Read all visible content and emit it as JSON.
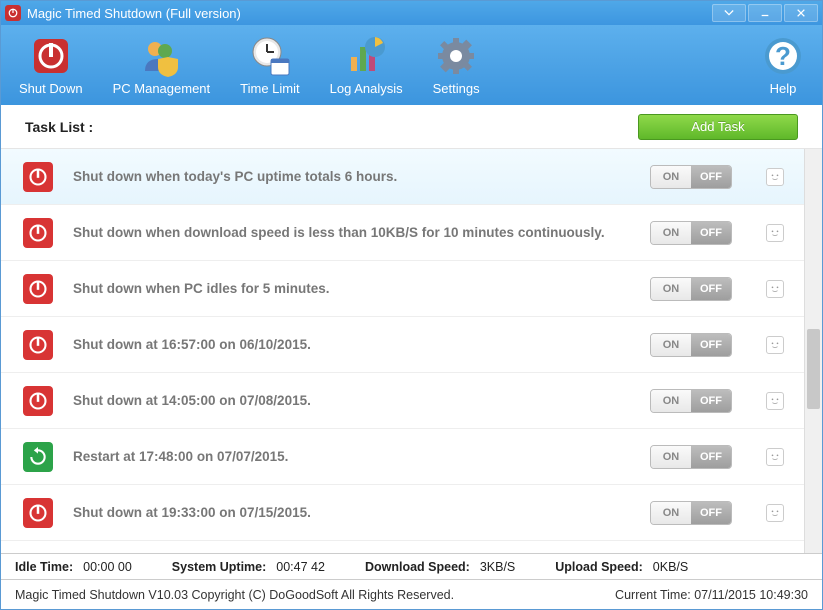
{
  "titlebar": {
    "title": "Magic Timed Shutdown (Full version)"
  },
  "toolbar": {
    "shutdown": "Shut Down",
    "pc_mgmt": "PC Management",
    "time_limit": "Time Limit",
    "log_analysis": "Log Analysis",
    "settings": "Settings",
    "help": "Help"
  },
  "header": {
    "label": "Task List :",
    "add_task": "Add Task"
  },
  "toggle": {
    "on": "ON",
    "off": "OFF"
  },
  "tasks": [
    {
      "type": "shutdown",
      "selected": true,
      "desc": "Shut down when today's PC uptime totals 6 hours."
    },
    {
      "type": "shutdown",
      "selected": false,
      "desc": "Shut down when download speed is less than 10KB/S for 10 minutes continuously."
    },
    {
      "type": "shutdown",
      "selected": false,
      "desc": "Shut down when PC idles for 5 minutes."
    },
    {
      "type": "shutdown",
      "selected": false,
      "desc": "Shut down at 16:57:00 on  06/10/2015."
    },
    {
      "type": "shutdown",
      "selected": false,
      "desc": "Shut down at 14:05:00 on  07/08/2015."
    },
    {
      "type": "restart",
      "selected": false,
      "desc": "Restart at 17:48:00 on  07/07/2015."
    },
    {
      "type": "shutdown",
      "selected": false,
      "desc": "Shut down at 19:33:00 on  07/15/2015."
    }
  ],
  "status": {
    "idle_label": "Idle Time:",
    "idle_value": "00:00 00",
    "uptime_label": "System Uptime:",
    "uptime_value": "00:47 42",
    "down_label": "Download Speed:",
    "down_value": "3KB/S",
    "up_label": "Upload Speed:",
    "up_value": "0KB/S"
  },
  "footer": {
    "copyright": "Magic Timed Shutdown V10.03  Copyright (C)  DoGoodSoft All Rights Reserved.",
    "current_time": "Current Time: 07/11/2015 10:49:30"
  }
}
